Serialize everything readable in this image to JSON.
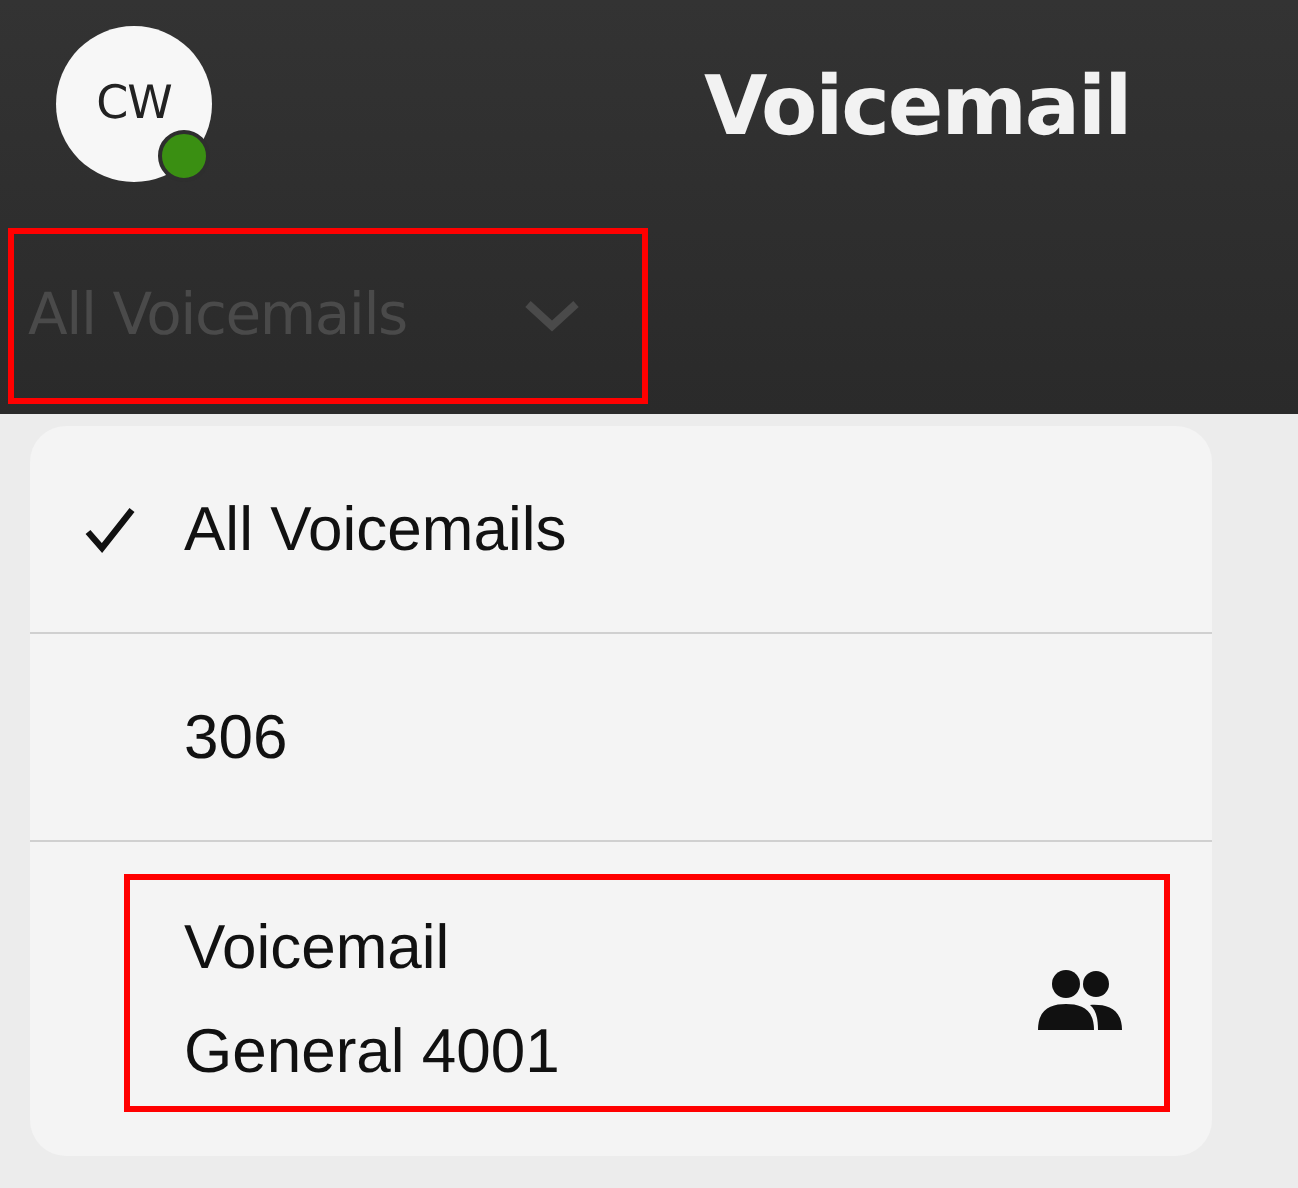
{
  "header": {
    "avatar": {
      "initials": "CW",
      "online": true
    },
    "title": "Voicemail"
  },
  "filter": {
    "label": "All Voicemails",
    "expanded": true,
    "highlighted": true
  },
  "menu": {
    "items": [
      {
        "lines": [
          "All Voicemails"
        ],
        "selected": true,
        "group": false,
        "highlighted": false
      },
      {
        "lines": [
          "306"
        ],
        "selected": false,
        "group": false,
        "highlighted": false
      },
      {
        "lines": [
          "Voicemail",
          "General 4001"
        ],
        "selected": false,
        "group": true,
        "highlighted": true
      }
    ]
  }
}
